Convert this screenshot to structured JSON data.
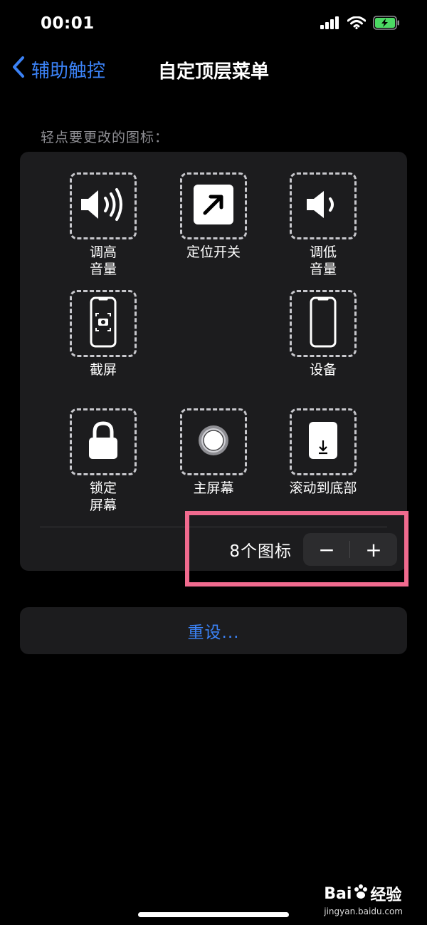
{
  "status": {
    "time": "00:01",
    "icons": [
      "cellular-icon",
      "wifi-icon",
      "battery-charging-icon"
    ],
    "battery_color": "#4cd964"
  },
  "nav": {
    "back_label": "辅助触控",
    "title": "自定顶层菜单"
  },
  "hint": "轻点要更改的图标：",
  "menu": {
    "volume_up": [
      "调高",
      "音量"
    ],
    "location": [
      "定位开关"
    ],
    "volume_down": [
      "调低",
      "音量"
    ],
    "screenshot": [
      "截屏"
    ],
    "device": [
      "设备"
    ],
    "lock_screen": [
      "锁定",
      "屏幕"
    ],
    "home": [
      "主屏幕"
    ],
    "scroll_bottom": [
      "滚动到底部"
    ]
  },
  "count": {
    "label": "8个图标",
    "minus": "−",
    "plus": "+"
  },
  "reset_label": "重设...",
  "watermark": {
    "logo_a": "Bai",
    "logo_b": "经验",
    "url": "jingyan.baidu.com"
  },
  "colors": {
    "accent": "#3b82f6",
    "highlight": "#f06a8e",
    "card": "#1c1c1e"
  }
}
